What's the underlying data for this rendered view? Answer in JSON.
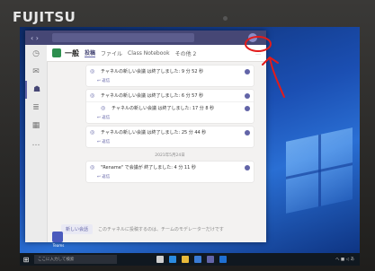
{
  "device": {
    "brand": "FUJITSU"
  },
  "teams": {
    "search_placeholder": "",
    "header": {
      "channel": "一般",
      "tabs": [
        "投稿",
        "ファイル",
        "Class Notebook"
      ],
      "more": "その他 2",
      "right": "…"
    },
    "rail": [
      {
        "icon": "activity-icon",
        "glyph": "◷"
      },
      {
        "icon": "chat-icon",
        "glyph": "✉"
      },
      {
        "icon": "teams-icon",
        "glyph": "☗"
      },
      {
        "icon": "assignments-icon",
        "glyph": "≣"
      },
      {
        "icon": "calendar-icon",
        "glyph": "▦"
      },
      {
        "icon": "more-icon",
        "glyph": "…"
      }
    ],
    "messages": [
      {
        "text": "チャネルの新しい会議 は終了しました: 9 分 52 秒",
        "reply": "↩ 返信"
      },
      {
        "text": "チャネルの新しい会議 は終了しました: 6 分 57 秒",
        "sub": "チャネルの新しい会議 は終了しました: 17 分 8 秒",
        "reply": "↩ 返信"
      },
      {
        "text": "チャネルの新しい会議 は終了しました: 25 分 44 秒",
        "reply": "↩ 返信"
      }
    ],
    "date_divider": "2021年5月24日",
    "last_message": {
      "text": "\"Rename\" で会議が 終了しました: 4 分 11 秒",
      "reply": "↩ 返信"
    },
    "compose": {
      "button": "新しい会話",
      "hint": "このチャネルに投稿するのは、チームのモデレーターだけです"
    }
  },
  "desktop": {
    "icon_label": "Teams",
    "taskbar": {
      "search_placeholder": "ここに入力して検索",
      "tray": "へ ■ ◁ あ"
    }
  },
  "colors": {
    "teams_purple": "#464775",
    "accent": "#6264a7",
    "annotation_red": "#e21b1b"
  }
}
